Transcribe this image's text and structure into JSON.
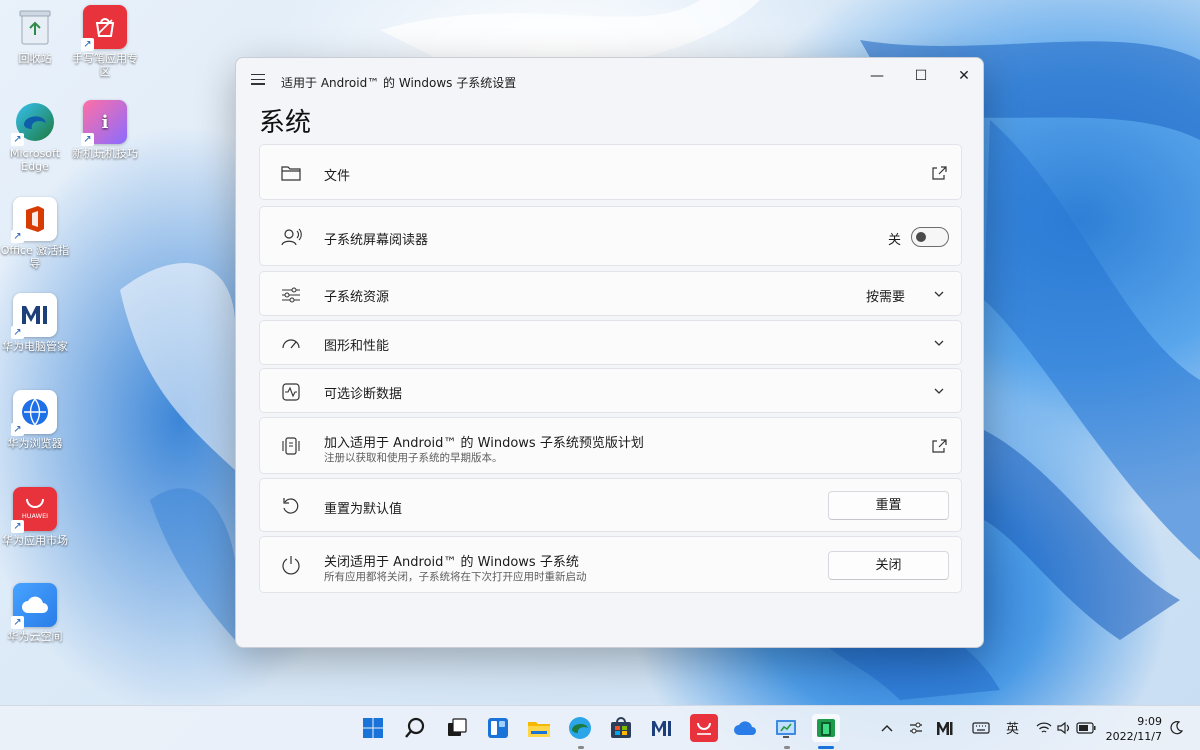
{
  "window": {
    "title": "适用于 Android™ 的 Windows 子系统设置",
    "minimize": "—",
    "maximize": "☐",
    "close": "✕",
    "page_title": "系统"
  },
  "settings": {
    "files": {
      "label": "文件",
      "icon": "folder-icon"
    },
    "screen_reader": {
      "label": "子系统屏幕阅读器",
      "state_label": "关",
      "on": false
    },
    "resources": {
      "label": "子系统资源",
      "value": "按需要"
    },
    "graphics": {
      "label": "图形和性能"
    },
    "diagnostics": {
      "label": "可选诊断数据"
    },
    "preview": {
      "label": "加入适用于 Android™ 的 Windows 子系统预览版计划",
      "sub": "注册以获取和使用子系统的早期版本。"
    },
    "reset": {
      "label": "重置为默认值",
      "button": "重置"
    },
    "shutdown": {
      "label": "关闭适用于 Android™ 的 Windows 子系统",
      "sub": "所有应用都将关闭，子系统将在下次打开应用时重新启动",
      "button": "关闭"
    }
  },
  "desktop_icons": [
    {
      "label": "回收站",
      "icon": "recycle-bin-icon"
    },
    {
      "label": "手写笔应用专区",
      "icon": "huawei-pen-store-icon"
    },
    {
      "label": "Microsoft Edge",
      "icon": "edge-icon"
    },
    {
      "label": "新机玩机技巧",
      "icon": "tips-icon"
    },
    {
      "label": "Office 激活指导",
      "icon": "office-icon"
    },
    {
      "label": "华为电脑管家",
      "icon": "pc-manager-icon"
    },
    {
      "label": "华为浏览器",
      "icon": "huawei-browser-icon"
    },
    {
      "label": "华为应用市场",
      "icon": "appgallery-icon"
    },
    {
      "label": "华为云空间",
      "icon": "huawei-cloud-icon"
    }
  ],
  "taskbar": {
    "appgallery_label": "HUAWEI",
    "tray_ime": "英",
    "time": "9:09",
    "date": "2022/11/7"
  },
  "colors": {
    "accent": "#1a73d9",
    "huawei_red": "#e8323c",
    "window_bg": "#f3f5f9"
  }
}
